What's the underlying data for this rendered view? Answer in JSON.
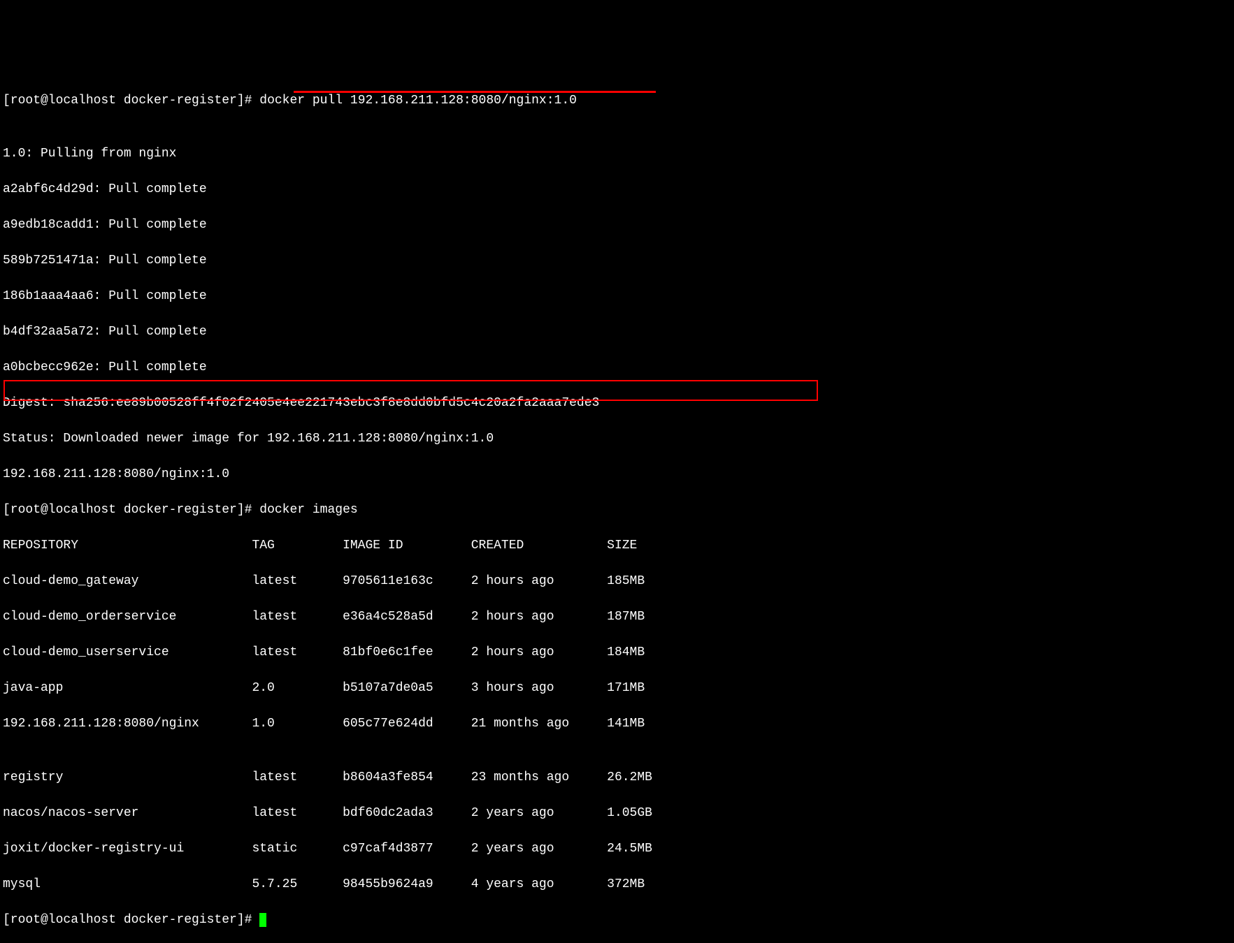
{
  "prompt1": "[root@localhost docker-register]# ",
  "command1": "docker pull 192.168.211.128:8080/nginx:1.0",
  "pull_output": [
    "1.0: Pulling from nginx",
    "a2abf6c4d29d: Pull complete",
    "a9edb18cadd1: Pull complete",
    "589b7251471a: Pull complete",
    "186b1aaa4aa6: Pull complete",
    "b4df32aa5a72: Pull complete",
    "a0bcbecc962e: Pull complete",
    "Digest: sha256:ee89b00528ff4f02f2405e4ee221743ebc3f8e8dd0bfd5c4c20a2fa2aaa7ede3",
    "Status: Downloaded newer image for 192.168.211.128:8080/nginx:1.0",
    "192.168.211.128:8080/nginx:1.0"
  ],
  "prompt2": "[root@localhost docker-register]# ",
  "command2": "docker images",
  "table_header": {
    "repository": "REPOSITORY",
    "tag": "TAG",
    "image_id": "IMAGE ID",
    "created": "CREATED",
    "size": "SIZE"
  },
  "images": [
    {
      "repository": "cloud-demo_gateway",
      "tag": "latest",
      "image_id": "9705611e163c",
      "created": "2 hours ago",
      "size": "185MB"
    },
    {
      "repository": "cloud-demo_orderservice",
      "tag": "latest",
      "image_id": "e36a4c528a5d",
      "created": "2 hours ago",
      "size": "187MB"
    },
    {
      "repository": "cloud-demo_userservice",
      "tag": "latest",
      "image_id": "81bf0e6c1fee",
      "created": "2 hours ago",
      "size": "184MB"
    },
    {
      "repository": "java-app",
      "tag": "2.0",
      "image_id": "b5107a7de0a5",
      "created": "3 hours ago",
      "size": "171MB"
    },
    {
      "repository": "192.168.211.128:8080/nginx",
      "tag": "1.0",
      "image_id": "605c77e624dd",
      "created": "21 months ago",
      "size": "141MB"
    },
    {
      "repository": "registry",
      "tag": "latest",
      "image_id": "b8604a3fe854",
      "created": "23 months ago",
      "size": "26.2MB"
    },
    {
      "repository": "nacos/nacos-server",
      "tag": "latest",
      "image_id": "bdf60dc2ada3",
      "created": "2 years ago",
      "size": "1.05GB"
    },
    {
      "repository": "joxit/docker-registry-ui",
      "tag": "static",
      "image_id": "c97caf4d3877",
      "created": "2 years ago",
      "size": "24.5MB"
    },
    {
      "repository": "mysql",
      "tag": "5.7.25",
      "image_id": "98455b9624a9",
      "created": "4 years ago",
      "size": "372MB"
    }
  ],
  "prompt3": "[root@localhost docker-register]# ",
  "annotations": {
    "underline_command1": true,
    "highlight_row_index": 4
  }
}
